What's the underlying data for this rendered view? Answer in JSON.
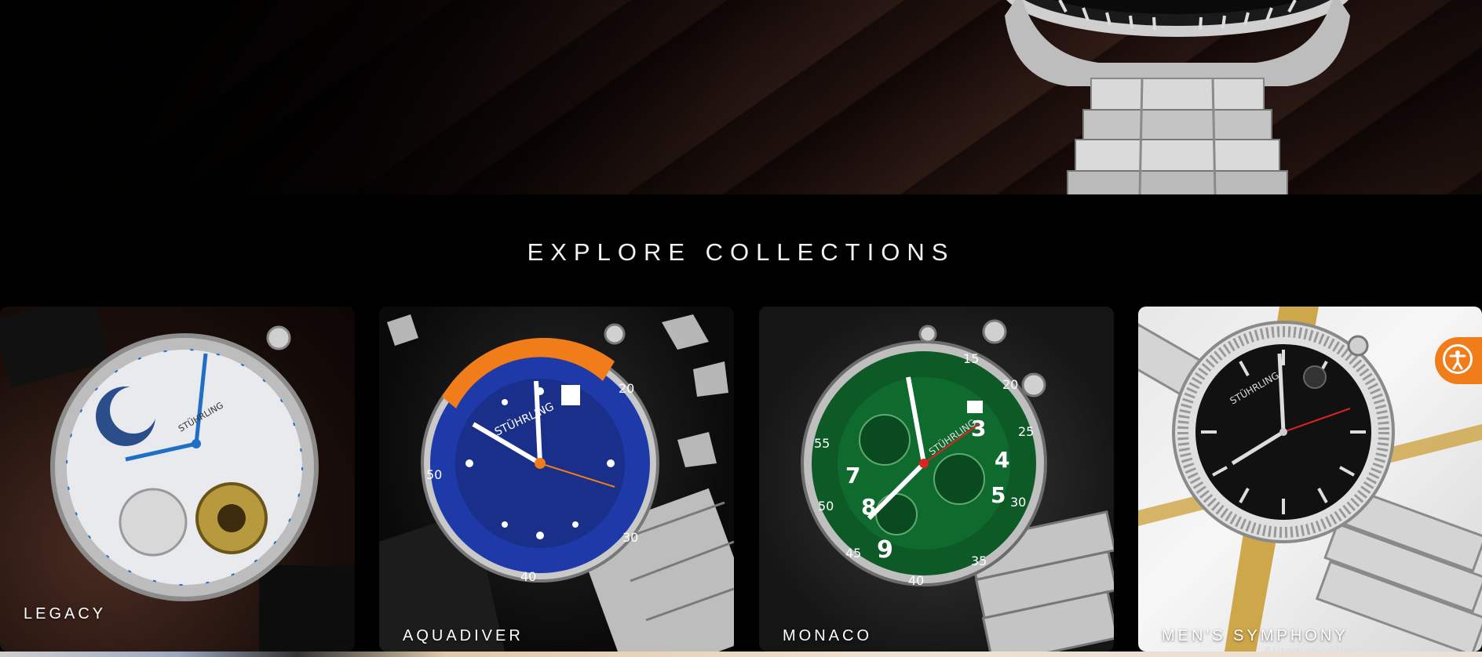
{
  "section": {
    "title": "EXPLORE COLLECTIONS"
  },
  "collections": [
    {
      "label": "LEGACY",
      "dial_color": "#e8eaee",
      "accent": "#1f6fc4"
    },
    {
      "label": "AQUADIVER",
      "dial_color": "#1a2f8a",
      "accent": "#f07c1a"
    },
    {
      "label": "MONACO",
      "dial_color": "#0f6a2e",
      "accent": "#ffffff"
    },
    {
      "label": "MEN'S SYMPHONY",
      "dial_color": "#111111",
      "accent": "#dddddd",
      "sublabel": "Automatic Windsor"
    }
  ],
  "accessibility": {
    "icon": "accessibility-icon",
    "color": "#f07c1a"
  },
  "colors": {
    "background": "#000000",
    "title": "#f2f2f2"
  }
}
